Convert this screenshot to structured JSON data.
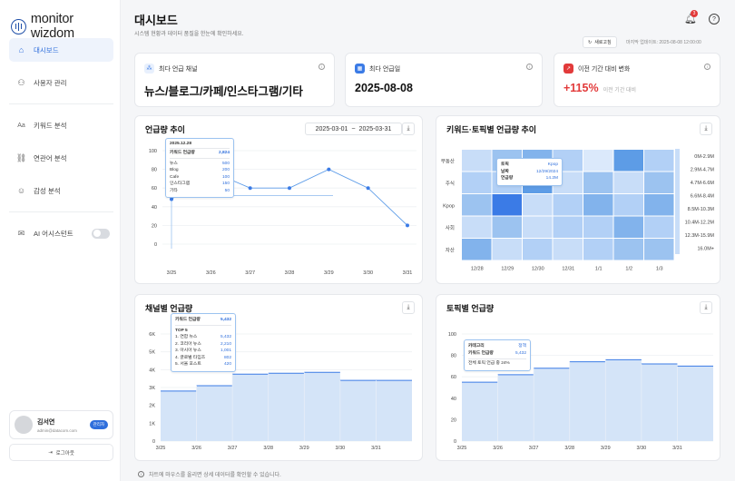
{
  "app": {
    "logo": "monitor wizdom"
  },
  "sidebar": {
    "items": [
      {
        "label": "대시보드",
        "icon": "home-icon"
      },
      {
        "label": "사용자 관리",
        "icon": "users-icon"
      },
      {
        "label": "키워드 분석",
        "icon": "text-icon"
      },
      {
        "label": "연관어 분석",
        "icon": "link-icon"
      },
      {
        "label": "감성 분석",
        "icon": "emotion-icon"
      },
      {
        "label": "AI 어시스턴트",
        "icon": "chat-icon"
      }
    ]
  },
  "user": {
    "name": "김서연",
    "email": "admin@datacom.com",
    "role": "관리자"
  },
  "logout_label": "로그아웃",
  "header": {
    "title": "대시보드",
    "subtitle": "시스템 현황과 데이터 품질을 한눈에 확인하세요.",
    "notification_count": "3",
    "refresh_label": "새로고침",
    "last_update": "마지막 업데이트: 2025-08-08 12:00:00"
  },
  "kpis": [
    {
      "label": "최다 언급 채널",
      "value": "뉴스/블로그/카페/인스타그램/기타",
      "accent": "#3b7be6"
    },
    {
      "label": "최다 언급일",
      "value": "2025-08-08",
      "accent": "#3b7be6"
    },
    {
      "label": "이전 기간 대비 변화",
      "value": "+115%",
      "note": "이전 기간 대비",
      "accent": "#e23a3a"
    }
  ],
  "mentions_trend": {
    "title": "언급량 추이",
    "date_from": "2025-03-01",
    "date_to": "2025-03-31",
    "tooltip": {
      "date": "2025.12.28",
      "total_label": "키워드 언급량",
      "total_value": "2,824",
      "rows": [
        {
          "label": "뉴스",
          "value": "500"
        },
        {
          "label": "Blog",
          "value": "200"
        },
        {
          "label": "Cafe",
          "value": "100"
        },
        {
          "label": "인스타그램",
          "value": "150"
        },
        {
          "label": "기타",
          "value": "50"
        }
      ]
    }
  },
  "heatmap": {
    "title": "키워드·토픽별 언급량 추이",
    "tooltip": {
      "topic_label": "토픽",
      "topic_value": "Kpop",
      "date_label": "날짜",
      "date_value": "12/29/2024",
      "amount_label": "언급량",
      "amount_value": "14.2M"
    }
  },
  "channel_mentions": {
    "title": "채널별 언급량",
    "tooltip": {
      "total_label": "키워드 언급량",
      "total_value": "5,432",
      "top_label": "TOP 5",
      "rows": [
        {
          "label": "1. 연합 뉴스",
          "value": "5,432"
        },
        {
          "label": "2. 코리아 뉴스",
          "value": "2,210"
        },
        {
          "label": "3. 아시아 뉴스",
          "value": "1,001"
        },
        {
          "label": "4. 글로벌 타임즈",
          "value": "802"
        },
        {
          "label": "5. 서울 포스트",
          "value": "420"
        }
      ]
    }
  },
  "topic_mentions": {
    "title": "토픽별 언급량",
    "tooltip": {
      "category_label": "카테고리",
      "category_value": "정책",
      "amount_label": "키워드 언급량",
      "amount_value": "5,432",
      "share_note": "전체 토픽 언급 중 24%"
    }
  },
  "footer_note": "차트에 마우스를 올리면 상세 데이터를 확인할 수 있습니다.",
  "chart_data": [
    {
      "type": "line",
      "title": "언급량 추이",
      "categories": [
        "3/25",
        "3/26",
        "3/27",
        "3/28",
        "3/29",
        "3/30",
        "3/31"
      ],
      "values": [
        48,
        78,
        60,
        60,
        80,
        60,
        20
      ],
      "ylim": [
        0,
        100
      ],
      "yticks": [
        0,
        20,
        40,
        60,
        80,
        100
      ],
      "color": "#5b9be8"
    },
    {
      "type": "heatmap",
      "title": "키워드·토픽별 언급량 추이",
      "x": [
        "12/28",
        "12/29",
        "12/30",
        "12/31",
        "1/1",
        "1/2",
        "1/3"
      ],
      "y": [
        "부동산",
        "주식",
        "Kpop",
        "사회",
        "자산"
      ],
      "values": [
        [
          2,
          4,
          5,
          3,
          1,
          6,
          3
        ],
        [
          3,
          3,
          6,
          2,
          4,
          2,
          4
        ],
        [
          4,
          7,
          2,
          3,
          5,
          3,
          5
        ],
        [
          2,
          4,
          2,
          3,
          3,
          5,
          3
        ],
        [
          5,
          2,
          3,
          2,
          3,
          4,
          4
        ]
      ],
      "legend": [
        "0M-2.9M",
        "2.9M-4.7M",
        "4.7M-6.6M",
        "6.6M-8.4M",
        "8.5M-10.3M",
        "10.4M-12.2M",
        "12.3M-15.9M",
        "16.0M+"
      ]
    },
    {
      "type": "area",
      "title": "채널별 언급량",
      "categories": [
        "3/25",
        "3/26",
        "3/27",
        "3/28",
        "3/29",
        "3/30",
        "3/31"
      ],
      "values": [
        2800,
        3100,
        3750,
        3800,
        3850,
        3400,
        3400
      ],
      "ylim": [
        0,
        6000
      ],
      "yticks": [
        "0",
        "1K",
        "2K",
        "3K",
        "4K",
        "5K",
        "6K"
      ],
      "color": "#5b9be8"
    },
    {
      "type": "area",
      "title": "토픽별 언급량",
      "categories": [
        "3/25",
        "3/26",
        "3/27",
        "3/28",
        "3/29",
        "3/30",
        "3/31"
      ],
      "values": [
        55,
        62,
        68,
        74,
        76,
        72,
        70
      ],
      "ylim": [
        0,
        100
      ],
      "yticks": [
        0,
        20,
        40,
        60,
        80,
        100
      ],
      "color": "#5b9be8"
    }
  ]
}
